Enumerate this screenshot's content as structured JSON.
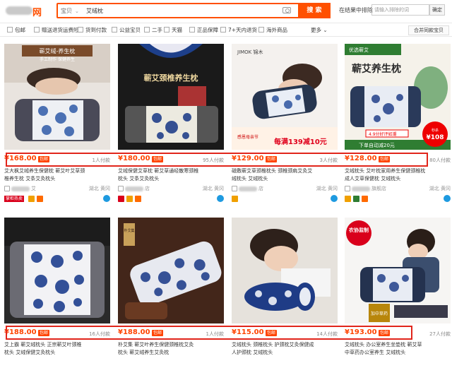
{
  "header": {
    "logo_text": "网",
    "search_scope": "宝贝",
    "query": "艾绒枕",
    "search_button": "搜 索",
    "within_label": "在结果中排除",
    "within_placeholder": "请输入排除的词",
    "within_button": "确定"
  },
  "filters": [
    {
      "label": "包邮"
    },
    {
      "label": "赠送退货运费险"
    },
    {
      "label": "货到付款"
    },
    {
      "label": "公益宝贝"
    },
    {
      "label": "二手"
    },
    {
      "label": "天猫"
    },
    {
      "label": "正品保障"
    },
    {
      "label": "7+天内退货"
    },
    {
      "label": "海外商品"
    }
  ],
  "more_label": "更多",
  "merge_button": "合并同款宝贝",
  "products": [
    {
      "price": "¥168.00",
      "free": "包邮",
      "buyers": "1人付款",
      "title_a": "艾大枫艾绒养生保健枕 蕲艾叶艾草颈",
      "title_b": "椎养生枕 艾条艾灸枕头",
      "shop": "艾",
      "loc": "湖北 黄冈"
    },
    {
      "price": "¥180.00",
      "free": "包邮",
      "buyers": "95人付款",
      "title_a": "艾绒保健艾草枕 蕲艾草通经散寒颈椎",
      "title_b": "枕头 艾条艾灸枕头",
      "shop": "店",
      "loc": "湖北 黄冈"
    },
    {
      "price": "¥129.00",
      "free": "包邮",
      "buyers": "3人付款",
      "title_a": "磁敷蕲艾草颈椎枕头 颈椎颈肩艾灸艾",
      "title_b": "绒枕头 艾绒枕头",
      "shop": "店",
      "loc": "湖北 黄冈"
    },
    {
      "price": "¥128.00",
      "free": "包邮",
      "buyers": "80人付款",
      "title_a": "艾绒枕头 艾叶枕家用养生保健颈椎枕",
      "title_b": "成人艾草保健枕 艾绒枕头",
      "shop": "旗舰店",
      "loc": "湖北 黄冈"
    },
    {
      "price": "¥188.00",
      "free": "包邮",
      "buyers": "16人付款",
      "title_a": "艾上霸 蕲艾绒枕头 正宗蕲艾叶颈椎",
      "title_b": "枕头 艾绒保健艾灸枕头",
      "shop": "店",
      "loc": "湖北 黄冈"
    },
    {
      "price": "¥188.00",
      "free": "包邮",
      "buyers": "1人付款",
      "title_a": "朴艾集 蕲艾叶养生保健颈椎枕艾灸",
      "title_b": "枕头 蕲艾绒养生艾灸枕",
      "shop": "店",
      "loc": "湖北 黄冈"
    },
    {
      "price": "¥115.00",
      "free": "包邮",
      "buyers": "14人付款",
      "title_a": "艾绒枕头 颈椎枕头 护颈枕艾灸保健成",
      "title_b": "人护颈枕 艾绒枕头",
      "shop": "店",
      "loc": "湖北 黄冈"
    },
    {
      "price": "¥193.00",
      "free": "包邮",
      "buyers": "27人付款",
      "title_a": "艾绒枕头 办公室养生坐垫枕 蕲艾草",
      "title_b": "中草药办公室养生 艾绒枕头",
      "shop": "店",
      "loc": "湖北 黄冈"
    }
  ],
  "image_text": {
    "p1_banner": "蕲艾绒-养生枕",
    "p1_sub": "手工制作 保健养生",
    "p2_title": "蕲艾颈椎养生枕",
    "p3_brand": "JIMOK 锦木",
    "p3_promo_left": "感恩母亲节",
    "p3_promo": "每满139减10元",
    "p4_top": "优选蕲艾",
    "p4_title": "蕲艾养生枕",
    "p4_rating": "4.9分好评如潮",
    "p4_bottom": "下单自动减20元",
    "p4_circle_label": "秒杀",
    "p4_circle_price": "¥108",
    "p6_label": "朴艾集",
    "p8_badge": "农协监制",
    "p8_tag": "加中草药"
  },
  "colors": {
    "accent": "#ff5000",
    "price": "#ff4400",
    "highlight_box": "#e1251b"
  }
}
